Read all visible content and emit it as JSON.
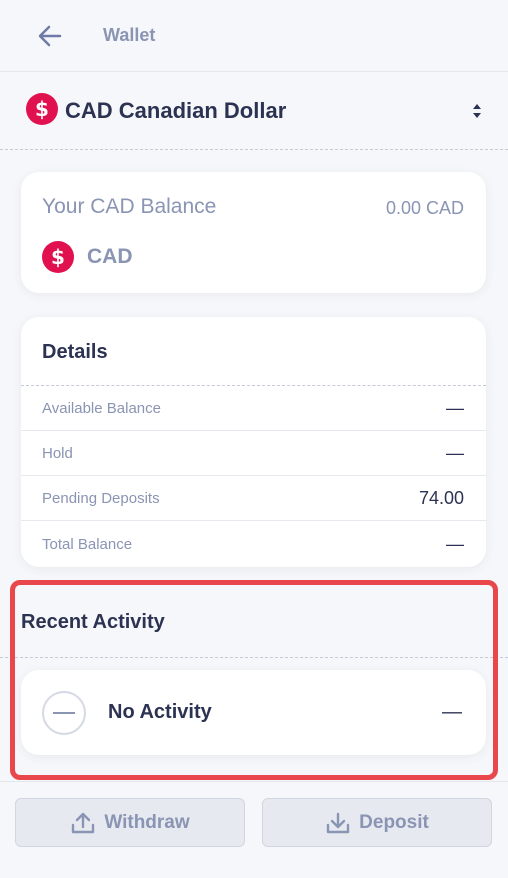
{
  "header": {
    "title": "Wallet",
    "back_icon": "arrow-left-icon"
  },
  "currency": {
    "code_name": "CAD Canadian Dollar",
    "symbol": "$",
    "selector_icon": "sort-updown-icon",
    "brand_color": "#e1114f"
  },
  "balance": {
    "title": "Your CAD Balance",
    "amount": "0.00 CAD",
    "symbol": "$",
    "code": "CAD"
  },
  "details": {
    "title": "Details",
    "rows": [
      {
        "label": "Available Balance",
        "value": "—"
      },
      {
        "label": "Hold",
        "value": "—"
      },
      {
        "label": "Pending Deposits",
        "value": "74.00"
      },
      {
        "label": "Total Balance",
        "value": "—"
      }
    ]
  },
  "recent": {
    "title": "Recent Activity",
    "item_label": "No Activity",
    "item_value": "—",
    "highlight_color": "#e8484c"
  },
  "actions": {
    "withdraw_label": "Withdraw",
    "deposit_label": "Deposit"
  }
}
